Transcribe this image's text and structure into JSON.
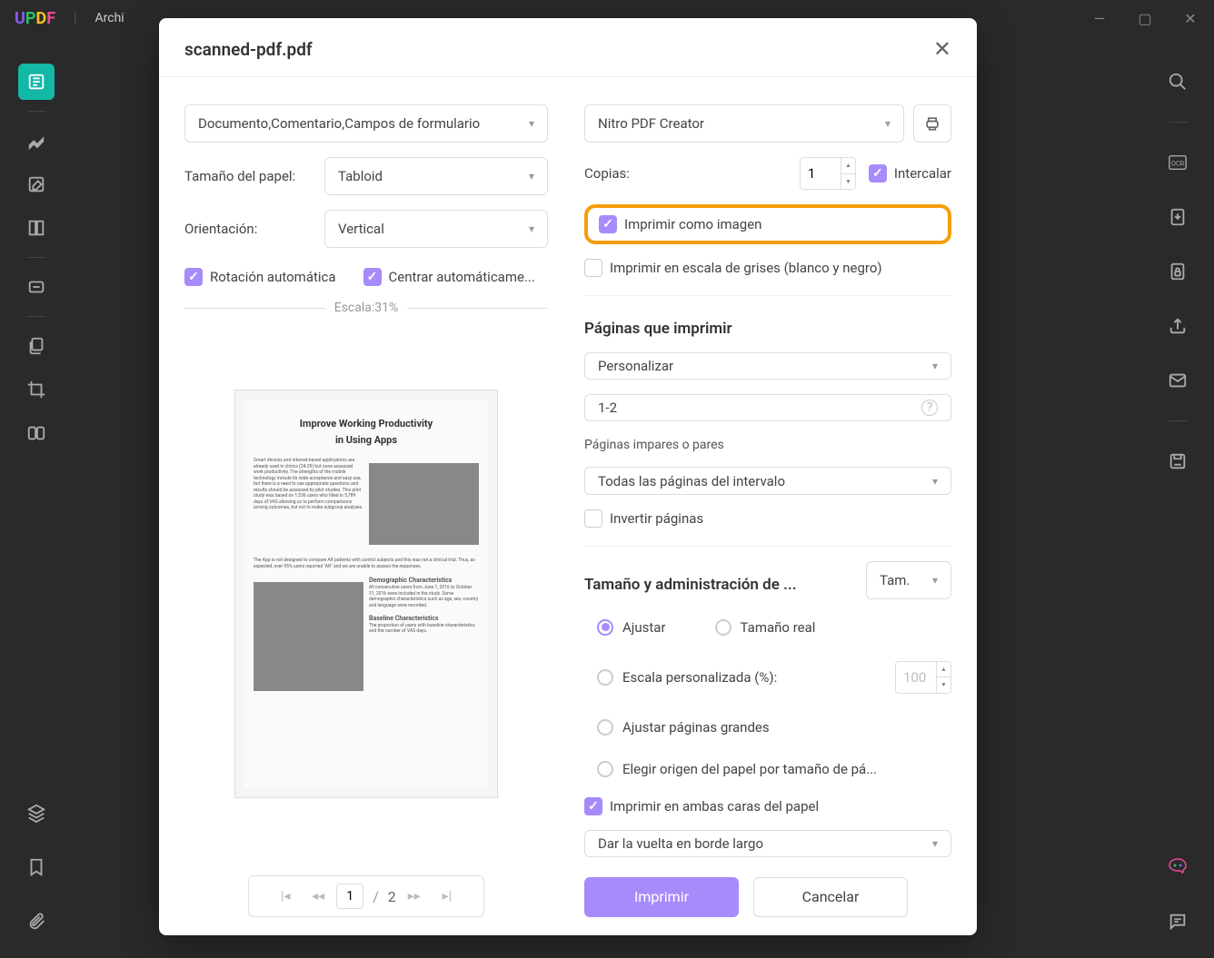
{
  "titlebar": {
    "menu": "Archi"
  },
  "modal": {
    "title": "scanned-pdf.pdf",
    "left": {
      "content_select": "Documento,Comentario,Campos de formulario",
      "paper_label": "Tamaño del papel:",
      "paper_value": "Tabloid",
      "orientation_label": "Orientación:",
      "orientation_value": "Vertical",
      "auto_rotate": "Rotación automática",
      "auto_center": "Centrar automáticame...",
      "scale_label": "Escala:31%",
      "preview": {
        "title": "Improve Working Productivity",
        "subtitle": "in Using Apps",
        "h1": "Demographic Characteristics",
        "h2": "Baseline Characteristics"
      },
      "pager": {
        "current": "1",
        "total": "2"
      }
    },
    "right": {
      "printer": "Nitro PDF Creator",
      "copies_label": "Copias:",
      "copies_value": "1",
      "collate": "Intercalar",
      "print_as_image": "Imprimir como imagen",
      "grayscale": "Imprimir en escala de grises (blanco y negro)",
      "pages_section": "Páginas que imprimir",
      "range_type": "Personalizar",
      "range_value": "1-2",
      "odd_even_label": "Páginas impares o pares",
      "odd_even_value": "Todas las páginas del intervalo",
      "invert": "Invertir páginas",
      "size_section": "Tamaño y administración de ...",
      "size_dropdown": "Tam.",
      "fit": "Ajustar",
      "actual": "Tamaño real",
      "custom_scale": "Escala personalizada (%):",
      "custom_scale_value": "100",
      "fit_large": "Ajustar páginas grandes",
      "choose_source": "Elegir origen del papel por tamaño de pá...",
      "duplex": "Imprimir en ambas caras del papel",
      "flip": "Dar la vuelta en borde largo",
      "print_btn": "Imprimir",
      "cancel_btn": "Cancelar"
    }
  }
}
